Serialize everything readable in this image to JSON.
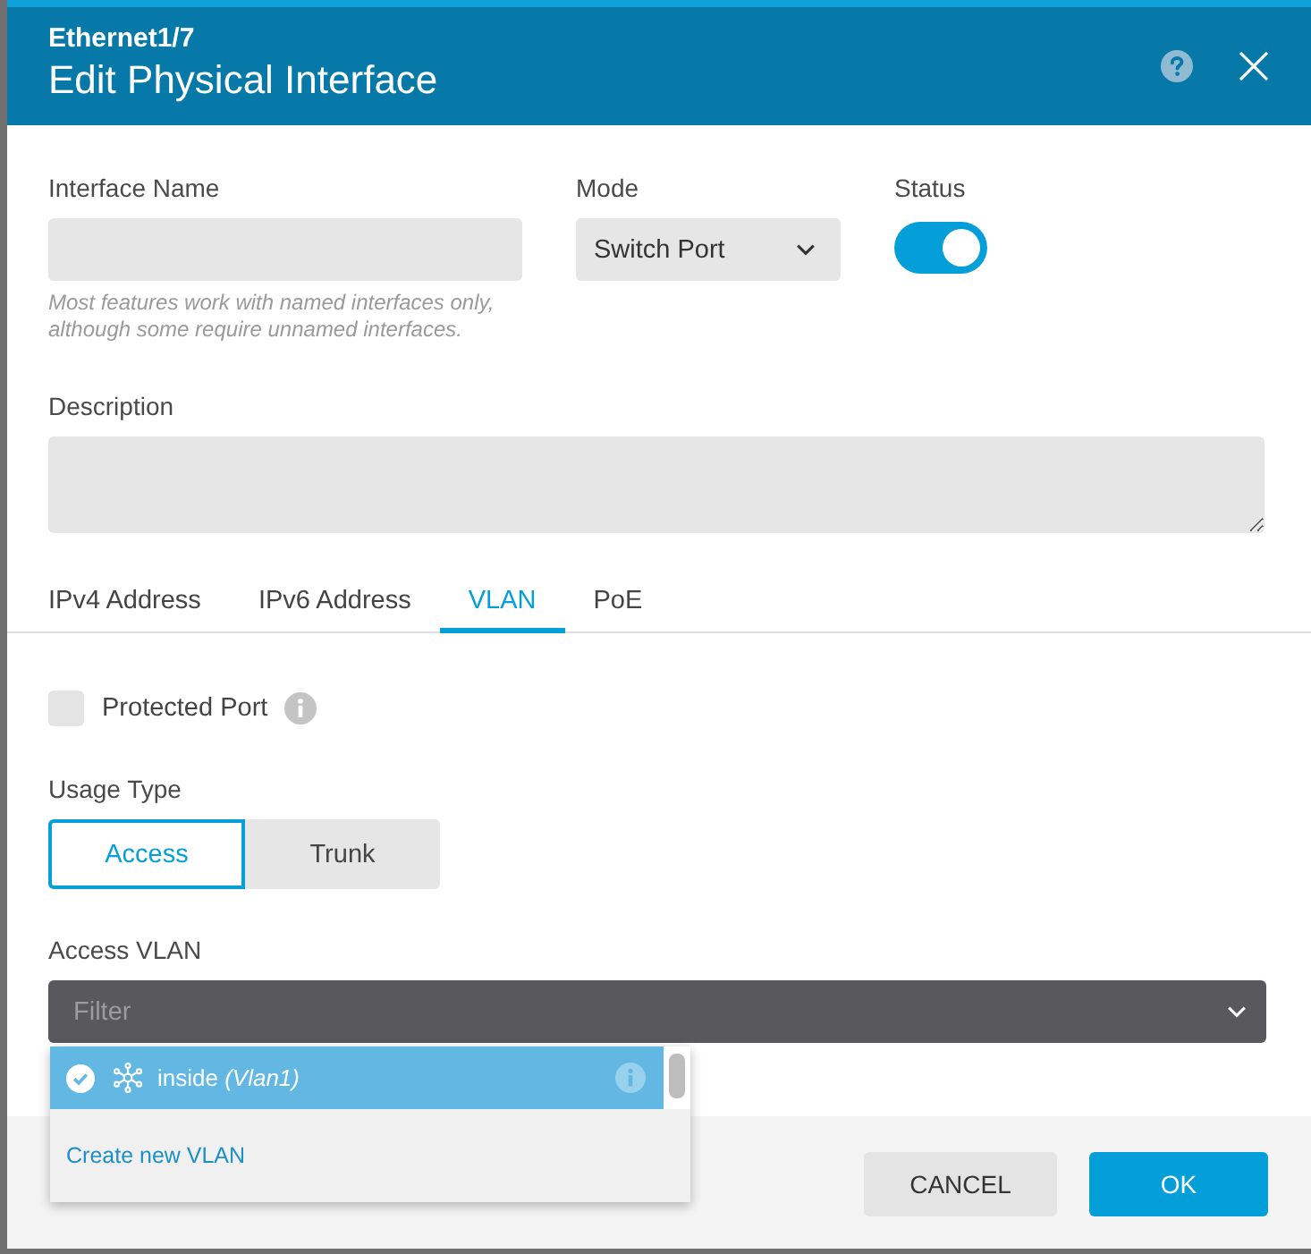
{
  "header": {
    "interface": "Ethernet1/7",
    "title": "Edit Physical Interface"
  },
  "interface_name": {
    "label": "Interface Name",
    "hint": "Most features work with named interfaces only, although some require unnamed interfaces."
  },
  "mode": {
    "label": "Mode",
    "value": "Switch Port"
  },
  "status": {
    "label": "Status",
    "on": true
  },
  "description": {
    "label": "Description"
  },
  "tabs": [
    {
      "label": "IPv4 Address",
      "selected": false
    },
    {
      "label": "IPv6 Address",
      "selected": false
    },
    {
      "label": "VLAN",
      "selected": true
    },
    {
      "label": "PoE",
      "selected": false
    }
  ],
  "protected_port": {
    "label": "Protected Port",
    "checked": false
  },
  "usage_type": {
    "label": "Usage Type",
    "options": [
      {
        "label": "Access",
        "selected": true
      },
      {
        "label": "Trunk",
        "selected": false
      }
    ]
  },
  "access_vlan": {
    "label": "Access VLAN",
    "placeholder": "Filter",
    "expanded": true,
    "items": [
      {
        "label": "inside *(Vlan1)*",
        "selected": true
      }
    ],
    "create_link": "Create new VLAN"
  },
  "buttons": [
    {
      "label": "CANCEL",
      "kind": "secondary"
    },
    {
      "label": "OK",
      "kind": "primary"
    }
  ]
}
